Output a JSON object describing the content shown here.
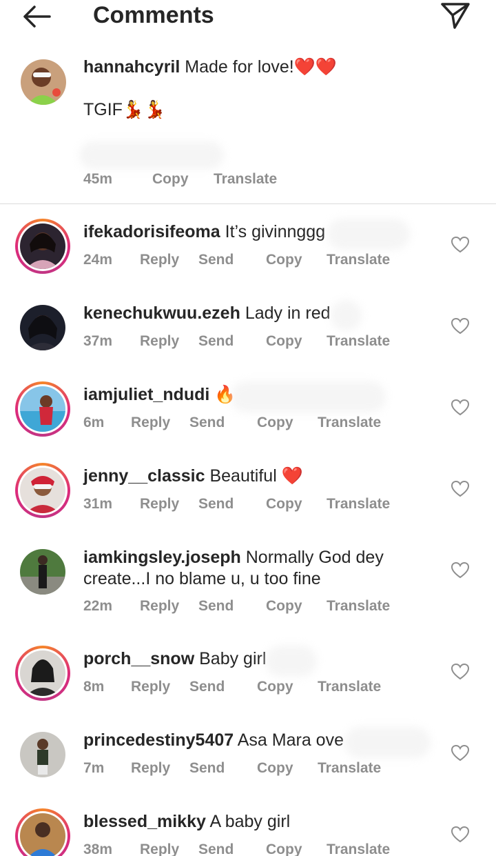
{
  "header": {
    "title": "Comments"
  },
  "caption": {
    "username": "hannahcyril",
    "text_line1": "Made for love!❤️❤️",
    "text_line2": "TGIF💃💃",
    "time": "45m",
    "copy": "Copy",
    "translate": "Translate"
  },
  "actions": {
    "reply": "Reply",
    "send": "Send",
    "copy": "Copy",
    "translate": "Translate"
  },
  "comments": [
    {
      "username": "ifekadorisifeoma",
      "text": "It’s givinnggg",
      "time": "24m"
    },
    {
      "username": "kenechukwuu.ezeh",
      "text": "Lady in red",
      "time": "37m"
    },
    {
      "username": "iamjuliet_ndudi",
      "text": "🔥",
      "time": "6m"
    },
    {
      "username": "jenny__classic",
      "text": "Beautiful ❤️",
      "time": "31m"
    },
    {
      "username": "iamkingsley.joseph",
      "text": "Normally God dey",
      "text2": "create...I no blame u, u too fine",
      "time": "22m"
    },
    {
      "username": "porch__snow",
      "text": "Baby girl",
      "time": "8m"
    },
    {
      "username": "princedestiny5407",
      "text": "Asa Mara ove",
      "time": "7m"
    },
    {
      "username": "blessed_mikky",
      "text": "A baby girl",
      "time": "38m"
    }
  ],
  "colors": {
    "text": "#262626",
    "secondary": "#8e8e8e",
    "divider": "#dbdbdb",
    "story_ring": [
      "#f58529",
      "#dd2a7b",
      "#c13584"
    ]
  }
}
